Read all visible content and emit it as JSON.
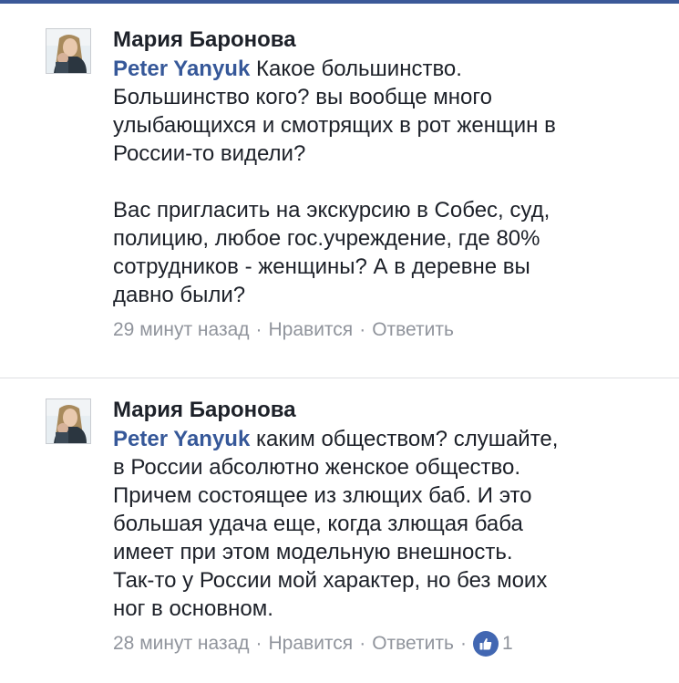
{
  "colors": {
    "accent": "#3b5998",
    "mention": "#365899",
    "meta": "#90949c",
    "like_badge": "#4267b2"
  },
  "comments": [
    {
      "author": "Мария Баронова",
      "mention": "Peter Yanyuk",
      "text": " Какое большинство.\nБольшинство кого? вы вообще много\nулыбающихся и смотрящих в рот женщин в\nРоссии-то видели?\n\nВас пригласить на экскурсию в Собес, суд,\nполицию, любое гос.учреждение, где 80%\nсотрудников - женщины? А в деревне вы\nдавно были?",
      "time": "29 минут назад",
      "like_label": "Нравится",
      "reply_label": "Ответить"
    },
    {
      "author": "Мария Баронова",
      "mention": "Peter Yanyuk",
      "text": " каким обществом? слушайте,\nв России абсолютно женское общество.\nПричем состоящее из злющих баб. И это\nбольшая удача еще, когда злющая баба\nимеет при этом модельную внешность.\nТак-то у России мой характер, но без моих\nног в основном.",
      "time": "28 минут назад",
      "like_label": "Нравится",
      "reply_label": "Ответить",
      "likes": "1",
      "like_icon": "thumbs-up-icon"
    }
  ],
  "separator": "·"
}
